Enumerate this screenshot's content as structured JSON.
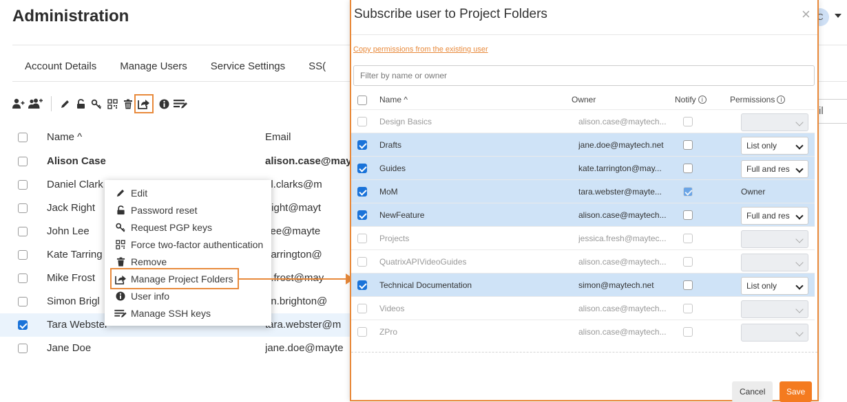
{
  "page": {
    "title": "Administration"
  },
  "tabs": [
    {
      "label": "Account Details"
    },
    {
      "label": "Manage Users"
    },
    {
      "label": "Service Settings"
    },
    {
      "label": "SS("
    }
  ],
  "toolbar": {
    "icons": [
      "add-user-icon",
      "add-users-icon",
      "pencil-icon",
      "lock-icon",
      "key-icon",
      "qr-code-icon",
      "trash-icon",
      "share-folder-icon",
      "info-icon",
      "ssh-keys-icon"
    ]
  },
  "users_table": {
    "headers": {
      "name": "Name ^",
      "email": "Email"
    },
    "rows": [
      {
        "name": "Alison Case",
        "email": "alison.case@may",
        "checked": false,
        "bold": true
      },
      {
        "name": "Daniel Clark",
        "email": "el.clarks@m",
        "checked": false,
        "bold": false
      },
      {
        "name": "Jack Right",
        "email": ".right@mayt",
        "checked": false,
        "bold": false
      },
      {
        "name": "John Lee",
        "email": ".lee@mayte",
        "checked": false,
        "bold": false
      },
      {
        "name": "Kate Tarring",
        "email": ".tarrington@",
        "checked": false,
        "bold": false
      },
      {
        "name": "Mike Frost",
        "email": "e.frost@may",
        "checked": false,
        "bold": false
      },
      {
        "name": "Simon Brigl",
        "email": "on.brighton@",
        "checked": false,
        "bold": false
      },
      {
        "name": "Tara Webster",
        "email": "tara.webster@m",
        "checked": true,
        "bold": false
      },
      {
        "name": "Jane Doe",
        "email": "jane.doe@mayte",
        "checked": false,
        "bold": false
      }
    ]
  },
  "context_menu": {
    "items": [
      {
        "label": "Edit",
        "icon": "pencil-icon"
      },
      {
        "label": "Password reset",
        "icon": "lock-icon"
      },
      {
        "label": "Request PGP keys",
        "icon": "key-icon"
      },
      {
        "label": "Force two-factor authentication",
        "icon": "qr-code-icon"
      },
      {
        "label": "Remove",
        "icon": "trash-icon"
      },
      {
        "label": "Manage Project Folders",
        "icon": "share-folder-icon"
      },
      {
        "label": "User info",
        "icon": "info-icon"
      },
      {
        "label": "Manage SSH keys",
        "icon": "ssh-keys-icon"
      }
    ]
  },
  "background_right": {
    "button_partial": "il",
    "avatar_initial": "C"
  },
  "modal": {
    "title": "Subscribe user to Project Folders",
    "close": "×",
    "copy_link": "Copy permissions from the existing user",
    "filter_placeholder": "Filter by name or owner",
    "headers": {
      "name": "Name ^",
      "owner": "Owner",
      "notify": "Notify",
      "permissions": "Permissions"
    },
    "info_glyph": "i",
    "rows": [
      {
        "name": "Design Basics",
        "owner": "alison.case@maytech...",
        "checked": false,
        "notify": false,
        "permission": "",
        "selected": false
      },
      {
        "name": "Drafts",
        "owner": "jane.doe@maytech.net",
        "checked": true,
        "notify": false,
        "permission": "List only",
        "selected": true
      },
      {
        "name": "Guides",
        "owner": "kate.tarrington@may...",
        "checked": true,
        "notify": false,
        "permission": "Full and res",
        "selected": true
      },
      {
        "name": "MoM",
        "owner": "tara.webster@mayte...",
        "checked": true,
        "notify": true,
        "permission": "Owner",
        "selected": true,
        "owner_row": true
      },
      {
        "name": "NewFeature",
        "owner": "alison.case@maytech...",
        "checked": true,
        "notify": false,
        "permission": "Full and res",
        "selected": true
      },
      {
        "name": "Projects",
        "owner": "jessica.fresh@maytec...",
        "checked": false,
        "notify": false,
        "permission": "",
        "selected": false
      },
      {
        "name": "QuatrixAPIVideoGuides",
        "owner": "alison.case@maytech...",
        "checked": false,
        "notify": false,
        "permission": "",
        "selected": false
      },
      {
        "name": "Technical Documentation",
        "owner": "simon@maytech.net",
        "checked": true,
        "notify": false,
        "permission": "List only",
        "selected": true
      },
      {
        "name": "Videos",
        "owner": "alison.case@maytech...",
        "checked": false,
        "notify": false,
        "permission": "",
        "selected": false
      },
      {
        "name": "ZPro",
        "owner": "alison.case@maytech...",
        "checked": false,
        "notify": false,
        "permission": "",
        "selected": false
      }
    ],
    "buttons": {
      "cancel": "Cancel",
      "save": "Save"
    }
  },
  "colors": {
    "accent": "#e8893a",
    "save_button": "#f47b20",
    "checkbox": "#1a73d9",
    "selected_row": "#cfe3f7"
  }
}
